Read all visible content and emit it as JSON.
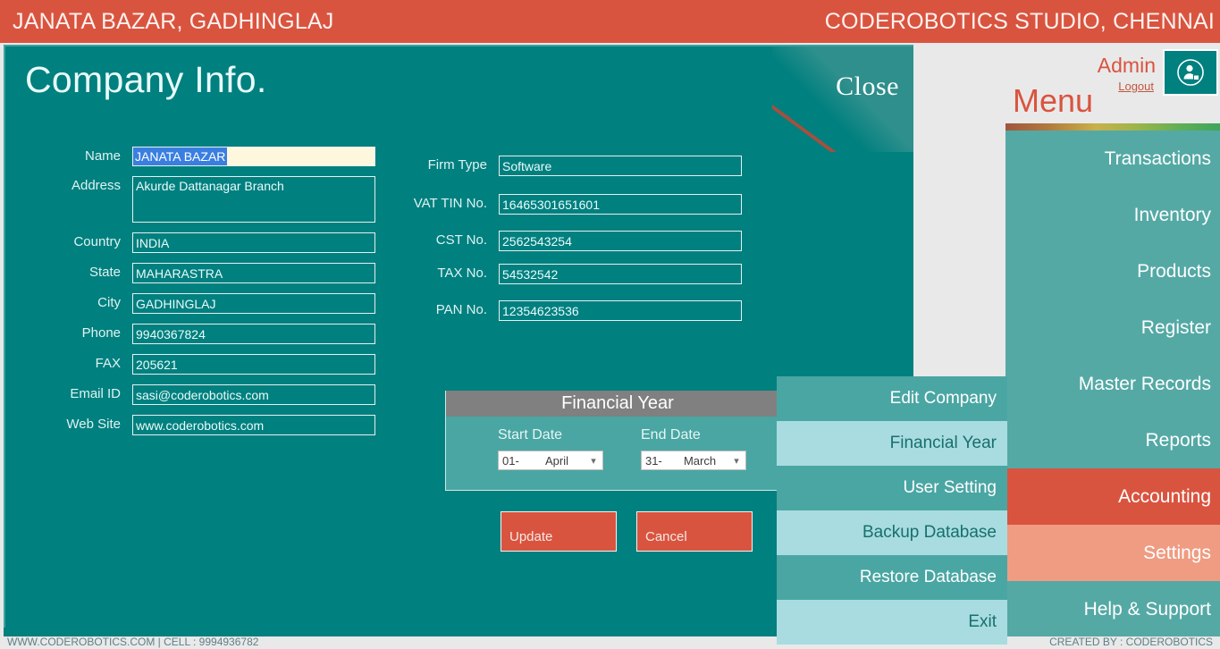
{
  "topbar": {
    "left_title": "JANATA BAZAR, GADHINGLAJ",
    "right_title": "CODEROBOTICS STUDIO, CHENNAI",
    "background": "#d9543f"
  },
  "window": {
    "title": "Company Info.",
    "close_label": "Close",
    "background": "#00807f"
  },
  "form": {
    "left": [
      {
        "label": "Name",
        "value": "JANATA BAZAR",
        "selected": true,
        "type": "text"
      },
      {
        "label": "Address",
        "value": "Akurde Dattanagar Branch",
        "selected": false,
        "type": "textarea"
      },
      {
        "label": "Country",
        "value": "INDIA",
        "selected": false,
        "type": "text"
      },
      {
        "label": "State",
        "value": "MAHARASTRA",
        "selected": false,
        "type": "text"
      },
      {
        "label": "City",
        "value": "GADHINGLAJ",
        "selected": false,
        "type": "text"
      },
      {
        "label": "Phone",
        "value": "9940367824",
        "selected": false,
        "type": "text"
      },
      {
        "label": "FAX",
        "value": "205621",
        "selected": false,
        "type": "text"
      },
      {
        "label": "Email ID",
        "value": "sasi@coderobotics.com",
        "selected": false,
        "type": "text"
      },
      {
        "label": "Web Site",
        "value": "www.coderobotics.com",
        "selected": false,
        "type": "text"
      }
    ],
    "right": [
      {
        "label": "Firm Type",
        "value": "Software"
      },
      {
        "label": "VAT TIN No.",
        "value": "16465301651601"
      },
      {
        "label": "CST No.",
        "value": "2562543254"
      },
      {
        "label": "TAX No.",
        "value": "54532542"
      },
      {
        "label": "PAN No.",
        "value": "12354623536"
      }
    ]
  },
  "financial_year": {
    "heading": "Financial Year",
    "start": {
      "caption": "Start Date",
      "day": "01-",
      "month": "April"
    },
    "end": {
      "caption": "End Date",
      "day": "31-",
      "month": "March"
    }
  },
  "buttons": {
    "update": "Update",
    "cancel": "Cancel"
  },
  "dropdown": {
    "items": [
      {
        "label": "Edit Company",
        "style": "dark"
      },
      {
        "label": "Financial Year",
        "style": "light"
      },
      {
        "label": "User Setting",
        "style": "dark"
      },
      {
        "label": "Backup Database",
        "style": "light"
      },
      {
        "label": "Restore Database",
        "style": "dark"
      },
      {
        "label": "Exit",
        "style": "light"
      }
    ]
  },
  "sidebar": {
    "admin_label": "Admin",
    "logout_label": "Logout",
    "menu_label": "Menu",
    "avatar_icon": "user-account-icon",
    "items": [
      {
        "label": "Transactions",
        "state": "normal"
      },
      {
        "label": "Inventory",
        "state": "normal"
      },
      {
        "label": "Products",
        "state": "normal"
      },
      {
        "label": "Register",
        "state": "normal"
      },
      {
        "label": "Master Records",
        "state": "normal"
      },
      {
        "label": "Reports",
        "state": "normal"
      },
      {
        "label": "Accounting",
        "state": "active"
      },
      {
        "label": "Settings",
        "state": "hover"
      },
      {
        "label": "Help & Support",
        "state": "normal"
      }
    ],
    "accent_strong": "#d9543f",
    "accent_soft": "#ef9c82",
    "background": "#54a9a5"
  },
  "footer": {
    "left": "WWW.CODEROBOTICS.COM   |   CELL : 9994936782",
    "right": "CREATED BY : CODEROBOTICS"
  }
}
